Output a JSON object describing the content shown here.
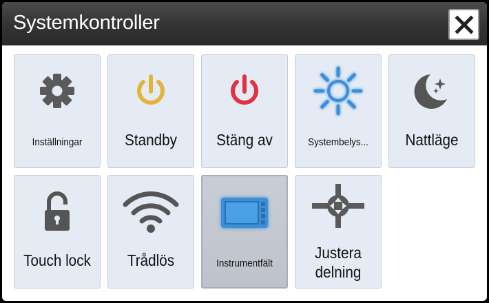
{
  "dialog": {
    "title": "Systemkontroller",
    "close_icon": "close-x-icon"
  },
  "tiles": [
    {
      "label": "Inställningar",
      "icon": "gear-icon",
      "color": "#5a5a5a"
    },
    {
      "label": "Standby",
      "icon": "power-icon",
      "color": "#e2b43a"
    },
    {
      "label": "Stäng av",
      "icon": "power-icon",
      "color": "#e0323f"
    },
    {
      "label": "Systembelys...",
      "icon": "sun-icon",
      "color": "#3b8fd8"
    },
    {
      "label": "Nattläge",
      "icon": "moon-stars-icon",
      "color": "#555555"
    },
    {
      "label": "Touch lock",
      "icon": "unlocked-padlock-icon",
      "color": "#555555"
    },
    {
      "label": "Trådlös",
      "icon": "wifi-icon",
      "color": "#555555"
    },
    {
      "label": "Instrumentfält",
      "icon": "instrument-panel-icon",
      "color": "#3b8fd8",
      "selected": true
    },
    {
      "label": "Justera delning",
      "icon": "split-adjust-icon",
      "color": "#5a5a5a"
    }
  ]
}
